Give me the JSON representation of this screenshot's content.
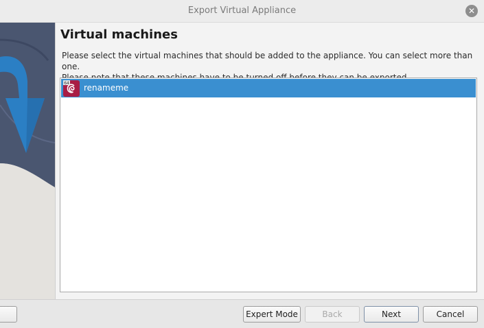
{
  "window": {
    "title": "Export Virtual Appliance",
    "close_symbol": "✕"
  },
  "page": {
    "heading": "Virtual machines",
    "description_line1": "Please select the virtual machines that should be added to the appliance. You can select more than one.",
    "description_line2": "Please note that these machines have to be turned off before they can be exported."
  },
  "vm_list": {
    "items": [
      {
        "name": "renameme",
        "icon": "debian-icon",
        "os_badge": "64",
        "selected": true
      }
    ]
  },
  "footer": {
    "left_button_label": "",
    "expert_mode_label": "Expert Mode",
    "back_label": "Back",
    "next_label": "Next",
    "cancel_label": "Cancel"
  },
  "colors": {
    "selection": "#3a8fd0",
    "banner_blue": "#2b7fc4",
    "banner_dark": "#4a5670"
  }
}
